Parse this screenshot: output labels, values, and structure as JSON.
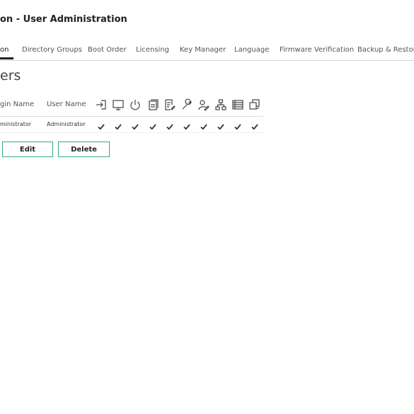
{
  "page": {
    "title": "on - User Administration"
  },
  "tabs": [
    {
      "label": "on",
      "active": true
    },
    {
      "label": "Directory Groups",
      "active": false
    },
    {
      "label": "Boot Order",
      "active": false
    },
    {
      "label": "Licensing",
      "active": false
    },
    {
      "label": "Key Manager",
      "active": false
    },
    {
      "label": "Language",
      "active": false
    },
    {
      "label": "Firmware Verification",
      "active": false
    },
    {
      "label": "Backup & Restore",
      "active": false
    }
  ],
  "section": {
    "title": "ers"
  },
  "users_table": {
    "columns": {
      "login_name": "gin Name",
      "user_name": "User Name"
    },
    "privilege_icons": [
      "login-icon",
      "remote-console-icon",
      "power-icon",
      "virtual-media-icon",
      "config-settings-icon",
      "wrench-icon",
      "user-edit-icon",
      "network-hierarchy-icon",
      "server-list-icon",
      "host-copy-icon"
    ],
    "rows": [
      {
        "login_name": "ministrator",
        "user_name": "Administrator",
        "privileges": [
          true,
          true,
          true,
          true,
          true,
          true,
          true,
          true,
          true,
          true
        ]
      }
    ]
  },
  "actions": {
    "edit_label": "Edit",
    "delete_label": "Delete"
  },
  "colors": {
    "button_border": "#34a884",
    "active_tab_underline": "#222222"
  }
}
